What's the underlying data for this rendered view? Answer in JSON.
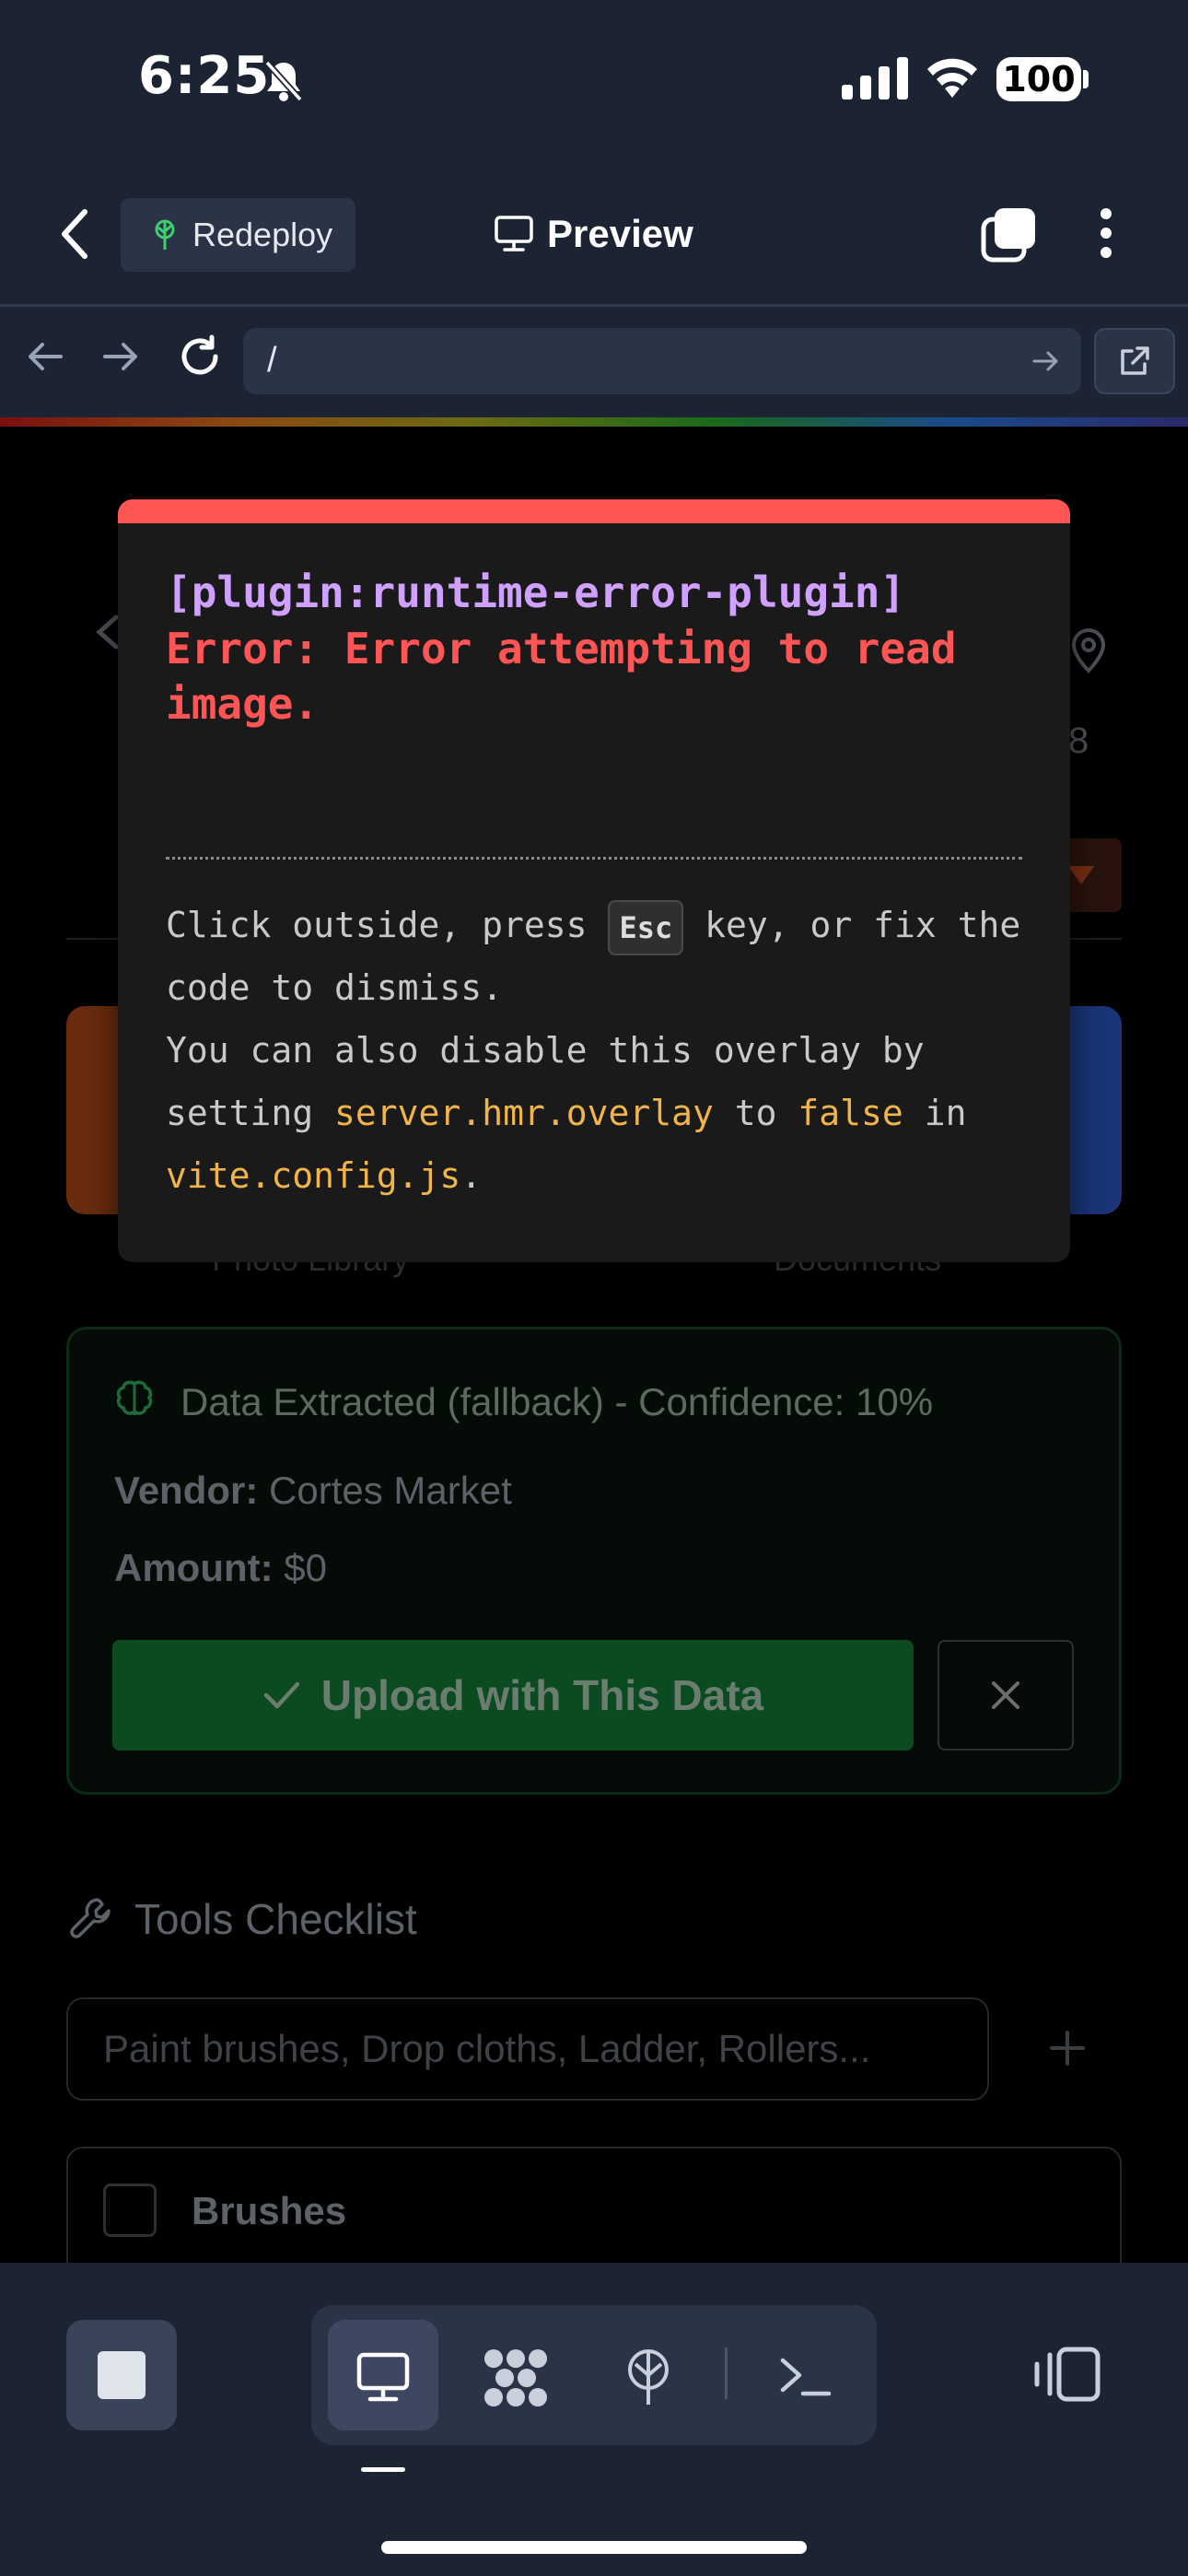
{
  "status_bar": {
    "time": "6:25",
    "battery": "100"
  },
  "header": {
    "redeploy_label": "Redeploy",
    "title": "Preview"
  },
  "browser": {
    "url": "/"
  },
  "underlying": {
    "partial_number": "8",
    "option_left_label": "Photo Library",
    "option_right_label": "Documents",
    "extract": {
      "title": "Data Extracted (fallback) - Confidence: 10%",
      "vendor_label": "Vendor:",
      "vendor_value": "Cortes Market",
      "amount_label": "Amount:",
      "amount_value": "$0",
      "upload_label": "Upload with This Data"
    },
    "tools": {
      "title": "Tools Checklist",
      "placeholder": "Paint brushes, Drop cloths, Ladder, Rollers...",
      "first_item": "Brushes"
    }
  },
  "overlay": {
    "plugin": "[plugin:runtime-error-plugin]",
    "error": "Error: Error attempting to read image.",
    "tip_part1": "Click outside, press",
    "key": "Esc",
    "tip_part2": "key, or fix the code to dismiss.",
    "tip_line3": "You can also disable this overlay by setting",
    "code1": "server.hmr.overlay",
    "to_text": "to",
    "code2": "false",
    "in_text": "in",
    "code3": "vite.config.js",
    "period": "."
  },
  "colors": {
    "overlay_accent": "#ff5555",
    "plugin_text": "#cfa0ff",
    "code_text": "#f0b44a",
    "app_chrome": "#1c2333"
  }
}
